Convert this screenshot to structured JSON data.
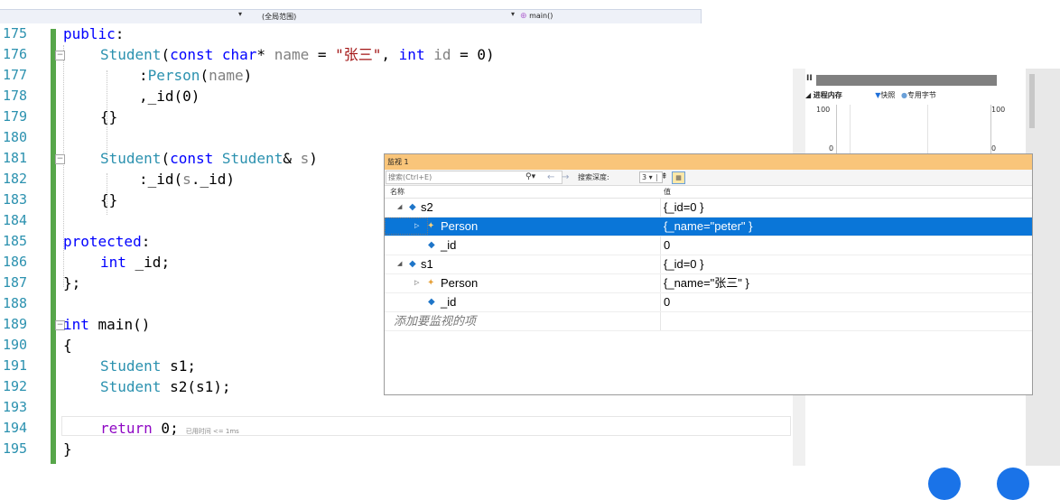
{
  "navbar": {
    "scope": "(全局范围)",
    "function": "main()"
  },
  "editor": {
    "perf_tip": "已用时间 <= 1ms",
    "lines": [
      {
        "no": "175"
      },
      {
        "no": "176"
      },
      {
        "no": "177"
      },
      {
        "no": "178"
      },
      {
        "no": "179"
      },
      {
        "no": "180"
      },
      {
        "no": "181"
      },
      {
        "no": "182"
      },
      {
        "no": "183"
      },
      {
        "no": "184"
      },
      {
        "no": "185"
      },
      {
        "no": "186"
      },
      {
        "no": "187"
      },
      {
        "no": "188"
      },
      {
        "no": "189"
      },
      {
        "no": "190"
      },
      {
        "no": "191"
      },
      {
        "no": "192"
      },
      {
        "no": "193"
      },
      {
        "no": "194"
      },
      {
        "no": "195"
      }
    ]
  },
  "diag": {
    "process_memory": "进程内存",
    "snapshot": "快照",
    "private_bytes": "专用字节",
    "pause": "II",
    "y_max_left": "100",
    "y_max_right": "100",
    "y_min_left": "0",
    "y_min_right": "0"
  },
  "watch": {
    "title": "监视 1",
    "search_placeholder": "搜索(Ctrl+E)",
    "search_depth_label": "搜索深度:",
    "search_depth_value": "3",
    "col_name": "名称",
    "col_value": "值",
    "rows": [
      {
        "name": "s2",
        "value": "{_id=0 }"
      },
      {
        "name": "Person",
        "value": "{_name=\"peter\" }"
      },
      {
        "name": "_id",
        "value": "0"
      },
      {
        "name": "s1",
        "value": "{_id=0 }"
      },
      {
        "name": "Person",
        "value": "{_name=\"张三\" }"
      },
      {
        "name": "_id",
        "value": "0"
      }
    ],
    "add_watch": "添加要监视的项"
  },
  "colors": {
    "keyword": "#0000ff",
    "type": "#2b91af",
    "string": "#a31515",
    "selection": "#0a76d8",
    "watch_title": "#f9c57a",
    "change_bar": "#57a64a"
  }
}
